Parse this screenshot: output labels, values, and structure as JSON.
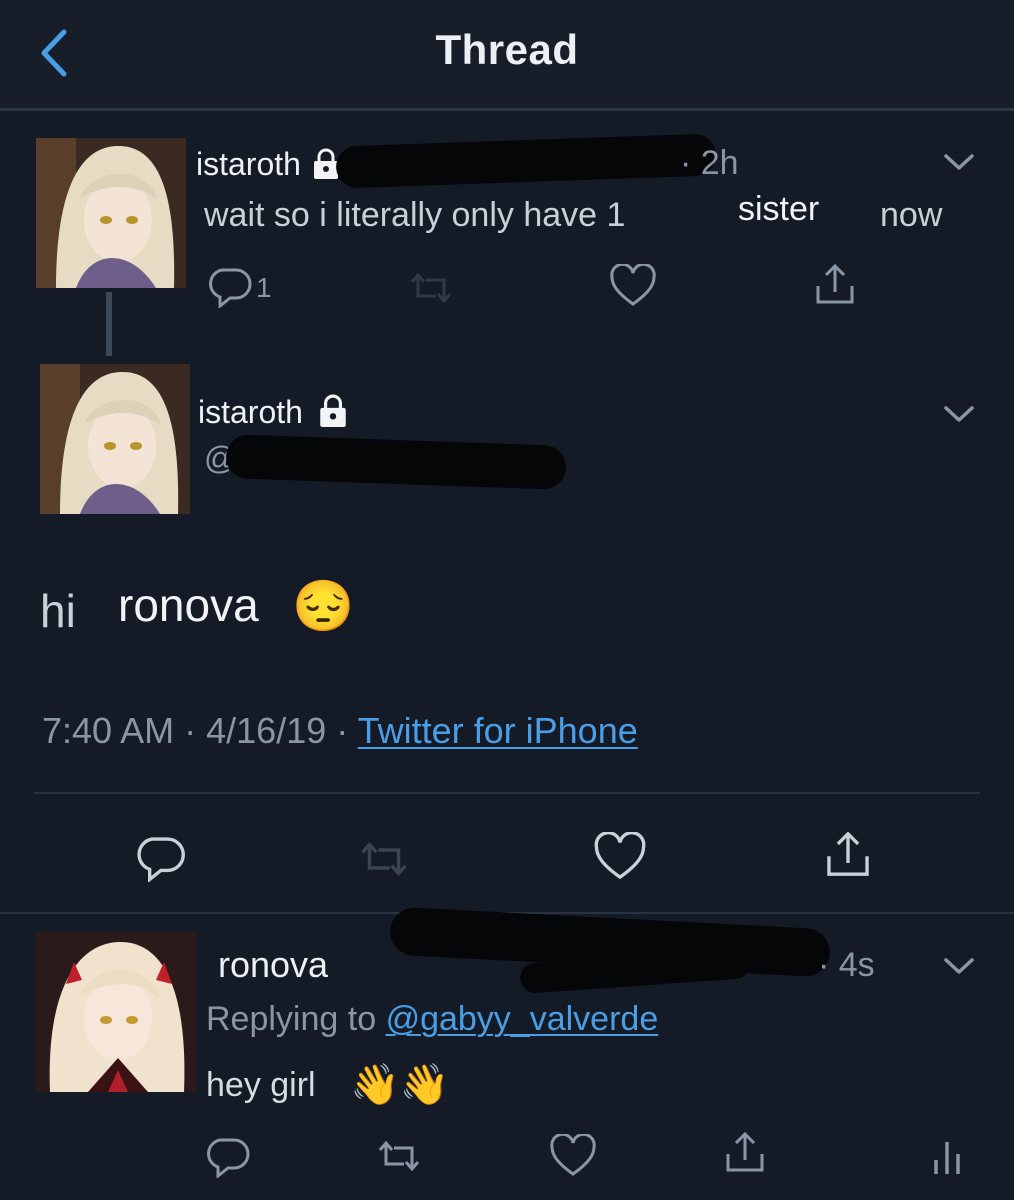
{
  "header": {
    "title": "Thread"
  },
  "tweet1": {
    "name": "istaroth",
    "age": "· 2h",
    "text": "wait so i literally only have 1",
    "text_emph": "sister",
    "text_end": "now",
    "reply_count": "1"
  },
  "tweet2": {
    "name": "istaroth",
    "handle_fragment": "@",
    "body_prefix": "hi",
    "body_main": "ronova",
    "emoji": "😔",
    "time": "7:40 AM",
    "date": "4/16/19",
    "sep": "·",
    "source": "Twitter for iPhone"
  },
  "tweet3": {
    "name": "ronova",
    "age": "· 4s",
    "replying_label": "Replying to",
    "replying_handle": "@gabyy_valverde",
    "text": "hey girl",
    "emoji": "👋👋"
  },
  "colors": {
    "background": "#151b26",
    "link": "#4a9ee6",
    "muted": "#8a96a5",
    "text": "#f1f3f5"
  },
  "icons": [
    "back-chevron-icon",
    "lock-icon",
    "reply-icon",
    "retweet-icon",
    "like-icon",
    "share-icon",
    "chevron-down-icon",
    "analytics-icon"
  ]
}
